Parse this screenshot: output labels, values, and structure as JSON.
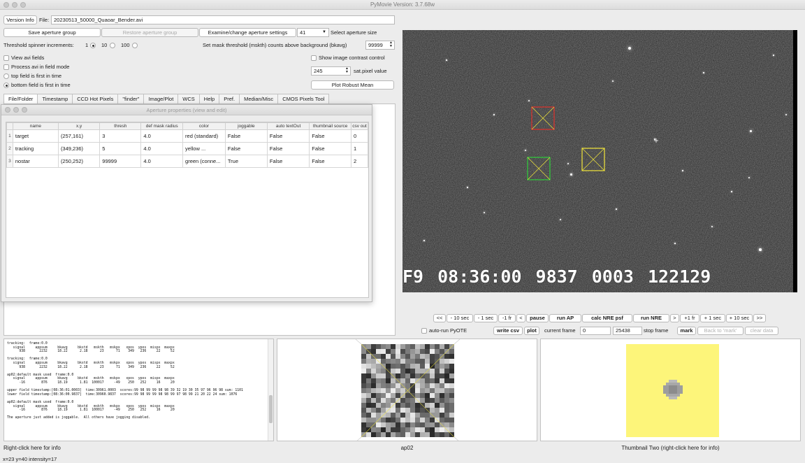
{
  "window": {
    "title": "PyMovie  Version: 3.7.68w"
  },
  "file_row": {
    "version_info_label": "Version Info",
    "file_label": "File:",
    "file_name": "20230513_50000_Quaoar_Bender.avi"
  },
  "aperture_row": {
    "save_label": "Save aperture group",
    "restore_label": "Restore aperture group",
    "examine_label": "Examine/change aperture settings",
    "size_value": "41",
    "size_label": "Select aperture size"
  },
  "threshold_row": {
    "label": "Threshold spinner increments:",
    "options": [
      "1",
      "10",
      "100"
    ],
    "mask_label": "Set mask threshold (mskth) counts above background (bkavg)",
    "mask_value": "99999"
  },
  "options": {
    "view_avi_fields": "View avi fields",
    "process_field_mode": "Process avi in field mode",
    "top_field_first": "top field is first in time",
    "bottom_field_first": "bottom field is first in time",
    "show_contrast": "Show image contrast control",
    "sat_value": "245",
    "sat_label": "sat.pixel value",
    "robust_mean_label": "Plot Robust Mean"
  },
  "tabs": [
    {
      "label": "File/Folder"
    },
    {
      "label": "Timestamp"
    },
    {
      "label": "CCD Hot Pixels"
    },
    {
      "label": "\"finder\""
    },
    {
      "label": "Image/Plot"
    },
    {
      "label": "WCS"
    },
    {
      "label": "Help"
    },
    {
      "label": "Pref."
    },
    {
      "label": "Median/Misc"
    },
    {
      "label": "CMOS Pixels Tool"
    }
  ],
  "dialog": {
    "title": "Aperture properties (view and edit)",
    "columns": [
      "name",
      "x,y",
      "thresh",
      "def mask radius",
      "color",
      "joggable",
      "auto textOut",
      "thumbnail source",
      "csv out"
    ],
    "rows": [
      {
        "num": "1",
        "cells": [
          "target",
          "(257,161)",
          "3",
          "4.0",
          "red (standard)",
          "False",
          "False",
          "False",
          "0"
        ]
      },
      {
        "num": "2",
        "cells": [
          "tracking",
          "(349,236)",
          "5",
          "4.0",
          "yellow ...",
          "False",
          "False",
          "False",
          "1"
        ]
      },
      {
        "num": "3",
        "cells": [
          "nostar",
          "(250,252)",
          "99999",
          "4.0",
          "green (conne...",
          "True",
          "False",
          "False",
          "2"
        ]
      }
    ]
  },
  "video": {
    "osd": [
      "F9",
      "08:36:00",
      "9837",
      "0003",
      "122129"
    ]
  },
  "controls": {
    "buttons": [
      "<<",
      "- 10 sec",
      "- 1 sec",
      "-1 fr",
      "<",
      "pause",
      "run AP",
      "calc NRE psf",
      "run NRE",
      ">",
      "+1 fr",
      "+ 1 sec",
      "+ 10 sec",
      ">>"
    ],
    "auto_run_pyote": "auto-run PyOTE",
    "write_csv": "write csv",
    "plot": "plot",
    "current_frame_label": "current frame",
    "current_frame_value": "0",
    "stop_frame_value": "25438",
    "stop_frame_label": "stop frame",
    "mark": "mark",
    "back_to_mark": "Back to 'mark'",
    "clear_data": "clear data"
  },
  "log": {
    "text": "tracking:  frame:0.0\n   signal     appsum     bkavg     bkstd   mskth   mskpx   xpos  ypos  mispx  maxpx\n      938       2232     18.22      2.18      23      71    349   236     22     52\n\ntracking:  frame:0.0\n   signal     appsum     bkavg     bkstd   mskth   mskpx   xpos  ypos  mispx  maxpx\n      938       2232     18.22      2.18      23      71    349   236     22     52\n\nap02:default mask used  frame:0.0\n   signal     appsum     bkavg     bkstd   mskth   mskpx   xpos  ypos  mispx  maxpx\n      -16        876     18.19      1.81  100017     -49    250   252     16     20\n\nupper field timestamp:[08:36:01.0003]  time:30961.0003  scores:99 98 99 99 98 98 39 32 19 30 35 97 96 96 98 sum: 1101\nlower field timestamp:[08:36:00.9837]  time:30960.9837  scores:99 98 99 99 98 98 99 97 98 99 21 20 22 24 sum: 1076\n\nap02:default mask used  frame:0.0\n   signal     appsum     bkavg     bkstd   mskth   mskpx   xpos  ypos  mispx  maxpx\n      -16        876     18.19      1.81  100017     -49    250   252     16     20\n\nThe aperture just added is joggable.  All others have jogging disabled."
  },
  "captions": {
    "left": "Right-click here for info",
    "middle": "ap02",
    "right": "Thumbnail Two (right-click here for info)"
  },
  "status_bar": "x=23 y=40 intensity=17",
  "colors": {
    "aperture_red": "#e0312b",
    "aperture_yellow": "#f2e63a",
    "aperture_green": "#2fcf3b",
    "thumbnail_two_bg": "#fdf57a"
  }
}
